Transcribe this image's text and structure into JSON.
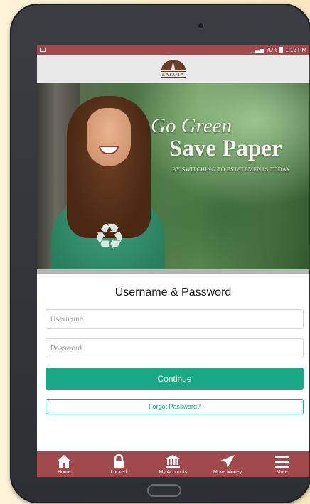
{
  "status_bar": {
    "battery": "70%",
    "time": "1:12 PM"
  },
  "logo": {
    "name": "LAKOTA"
  },
  "banner": {
    "line1": "Go Green",
    "line2": "Save Paper",
    "line3": "BY SWITCHING TO ESTATEMENTS TODAY"
  },
  "login": {
    "title": "Username & Password",
    "username_placeholder": "Username",
    "password_placeholder": "Password",
    "continue_label": "Continue",
    "forgot_label": "Forgot Password?"
  },
  "bottom_nav": {
    "items": [
      {
        "label": "Home",
        "icon": "home-icon"
      },
      {
        "label": "Locked",
        "icon": "lock-icon"
      },
      {
        "label": "My Accounts",
        "icon": "bank-icon"
      },
      {
        "label": "Move Money",
        "icon": "send-icon"
      },
      {
        "label": "More",
        "icon": "menu-icon"
      }
    ]
  },
  "colors": {
    "brand": "#a04a4e",
    "accent": "#1aa987"
  }
}
